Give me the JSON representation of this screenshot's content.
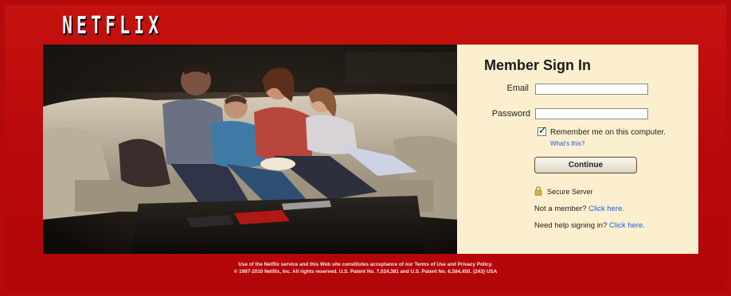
{
  "brand": {
    "logo_text": "NETFLIX"
  },
  "signin": {
    "title": "Member Sign In",
    "email_label": "Email",
    "email_value": "",
    "password_label": "Password",
    "password_value": "",
    "remember_checked": true,
    "remember_label": "Remember me on this computer.",
    "whats_this": "What's this?",
    "continue_label": "Continue",
    "secure_label": "Secure Server",
    "not_member_text": "Not a member?",
    "not_member_link": "Click here.",
    "help_text": "Need help signing in?",
    "help_link": "Click here."
  },
  "footer": {
    "line1_text": "Use of the Netflix service and this Web site constitutes acceptance of our",
    "terms_link": "Terms of Use",
    "and_text": "and",
    "privacy_link": "Privacy Policy.",
    "line2": "© 1997-2010 Netflix, Inc. All rights reserved.     U.S. Patent No. 7,024,381 and U.S. Patent No. 6,584,450.     {243} USA"
  },
  "colors": {
    "brand_red": "#c1090b",
    "panel_bg": "#fbefcf",
    "link_blue": "#1c5fd3"
  },
  "icons": {
    "lock": "lock-icon",
    "checkmark": "checkmark-icon"
  },
  "hero_image": {
    "subject": "family on couch"
  }
}
